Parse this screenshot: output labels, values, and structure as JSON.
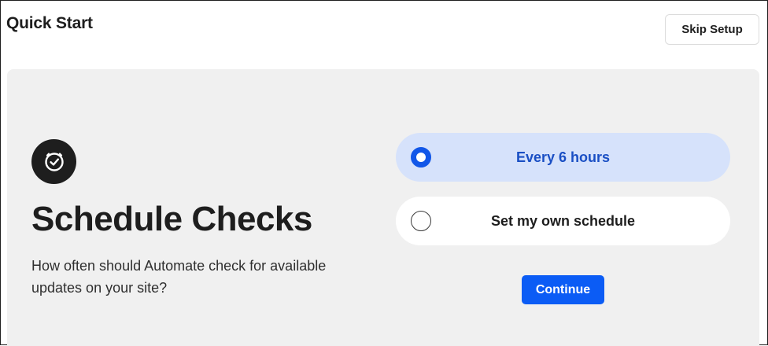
{
  "header": {
    "title": "Quick Start",
    "skip_label": "Skip Setup"
  },
  "step": {
    "icon": "clock-icon",
    "heading": "Schedule Checks",
    "description": "How often should Automate check for available updates on your site?"
  },
  "options": [
    {
      "label": "Every 6 hours",
      "selected": true
    },
    {
      "label": "Set my own schedule",
      "selected": false
    }
  ],
  "actions": {
    "continue_label": "Continue"
  },
  "colors": {
    "accent": "#0b5cf5",
    "selected_option_bg": "#d6e2fb",
    "selected_option_text": "#1a4fc4",
    "panel_bg": "#f0f0f0",
    "text_dark": "#1e1e1e"
  }
}
